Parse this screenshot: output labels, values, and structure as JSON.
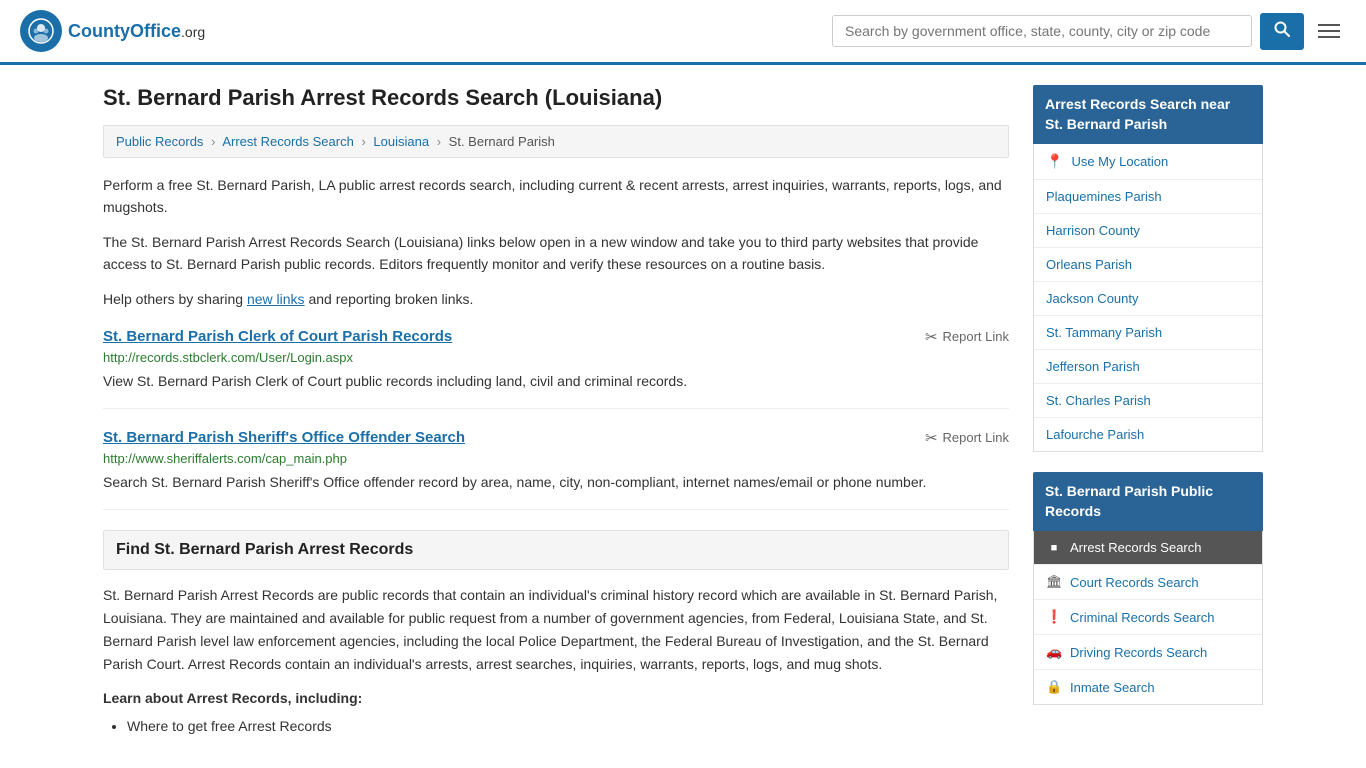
{
  "header": {
    "logo_text": "CountyOffice",
    "logo_suffix": ".org",
    "search_placeholder": "Search by government office, state, county, city or zip code",
    "search_btn_label": "🔍"
  },
  "breadcrumb": {
    "items": [
      {
        "label": "Public Records",
        "href": "#"
      },
      {
        "label": "Arrest Records Search",
        "href": "#"
      },
      {
        "label": "Louisiana",
        "href": "#"
      },
      {
        "label": "St. Bernard Parish",
        "href": "#"
      }
    ]
  },
  "page": {
    "title": "St. Bernard Parish Arrest Records Search (Louisiana)",
    "desc1": "Perform a free St. Bernard Parish, LA public arrest records search, including current & recent arrests, arrest inquiries, warrants, reports, logs, and mugshots.",
    "desc2": "The St. Bernard Parish Arrest Records Search (Louisiana) links below open in a new window and take you to third party websites that provide access to St. Bernard Parish public records. Editors frequently monitor and verify these resources on a routine basis.",
    "desc3_pre": "Help others by sharing ",
    "desc3_link": "new links",
    "desc3_post": " and reporting broken links."
  },
  "records": [
    {
      "title": "St. Bernard Parish Clerk of Court Parish Records",
      "url": "http://records.stbclerk.com/User/Login.aspx",
      "desc": "View St. Bernard Parish Clerk of Court public records including land, civil and criminal records.",
      "report_label": "Report Link"
    },
    {
      "title": "St. Bernard Parish Sheriff's Office Offender Search",
      "url": "http://www.sheriffalerts.com/cap_main.php",
      "desc": "Search St. Bernard Parish Sheriff's Office offender record by area, name, city, non-compliant, internet names/email or phone number.",
      "report_label": "Report Link"
    }
  ],
  "find_section": {
    "header": "Find St. Bernard Parish Arrest Records",
    "body": "St. Bernard Parish Arrest Records are public records that contain an individual's criminal history record which are available in St. Bernard Parish, Louisiana. They are maintained and available for public request from a number of government agencies, from Federal, Louisiana State, and St. Bernard Parish level law enforcement agencies, including the local Police Department, the Federal Bureau of Investigation, and the St. Bernard Parish Court. Arrest Records contain an individual's arrests, arrest searches, inquiries, warrants, reports, logs, and mug shots.",
    "learn_title": "Learn about Arrest Records, including:",
    "learn_list": [
      "Where to get free Arrest Records"
    ]
  },
  "sidebar": {
    "nearby_header": "Arrest Records Search near St. Bernard Parish",
    "use_location_label": "Use My Location",
    "nearby_links": [
      "Plaquemines Parish",
      "Harrison County",
      "Orleans Parish",
      "Jackson County",
      "St. Tammany Parish",
      "Jefferson Parish",
      "St. Charles Parish",
      "Lafourche Parish"
    ],
    "public_records_header": "St. Bernard Parish Public Records",
    "public_records_links": [
      {
        "label": "Arrest Records Search",
        "icon": "■",
        "active": true
      },
      {
        "label": "Court Records Search",
        "icon": "🏛",
        "active": false
      },
      {
        "label": "Criminal Records Search",
        "icon": "❗",
        "active": false
      },
      {
        "label": "Driving Records Search",
        "icon": "🚗",
        "active": false
      },
      {
        "label": "Inmate Search",
        "icon": "🔒",
        "active": false
      }
    ]
  }
}
